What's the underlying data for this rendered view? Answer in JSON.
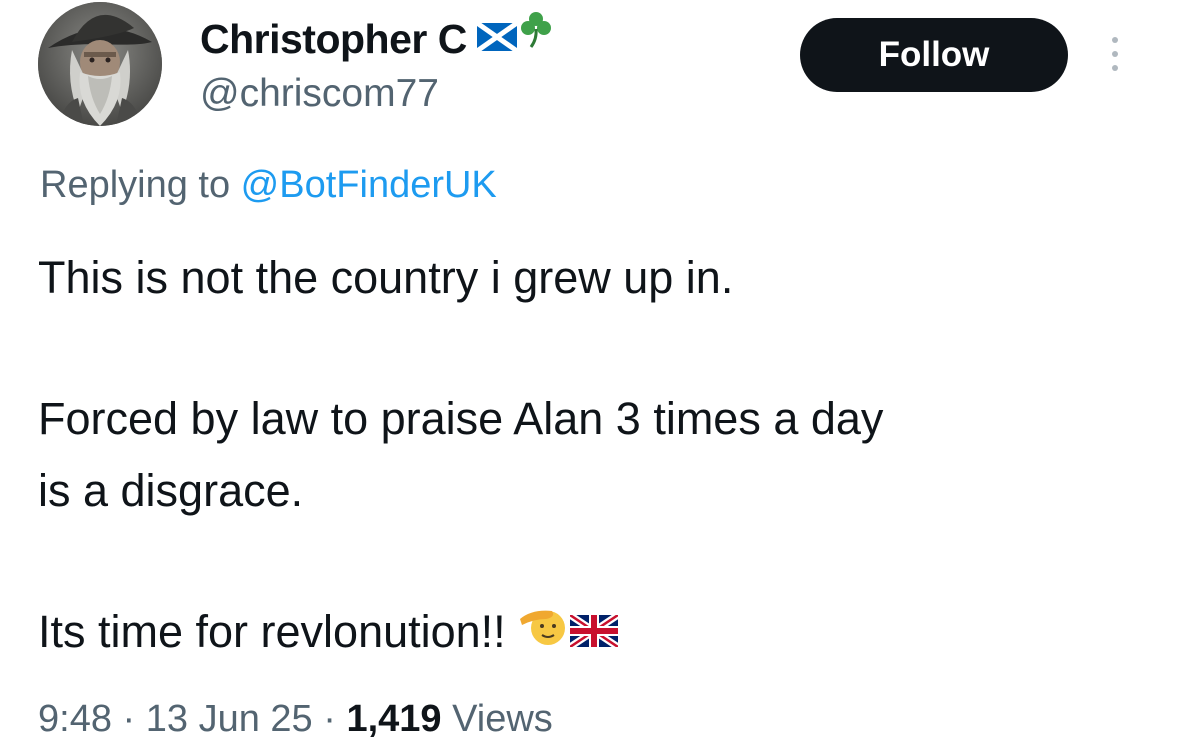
{
  "author": {
    "display_name": "Christopher C",
    "handle": "@chriscom77",
    "avatar": "wizard-portrait-avatar",
    "badges": [
      "scotland-flag-icon",
      "shamrock-icon"
    ]
  },
  "actions": {
    "follow_label": "Follow",
    "more_icon": "more-vertical-icon"
  },
  "reply": {
    "prefix": "Replying to ",
    "mention": "@BotFinderUK"
  },
  "tweet": {
    "line1": "This is not the country i grew up in.",
    "line2": "Forced by law to praise Alan 3 times a day",
    "line3": "is a disgrace.",
    "line4": "Its time for revlonution!!",
    "emojis": [
      "saluting-face-icon",
      "uk-flag-icon"
    ]
  },
  "meta": {
    "time": "9:48",
    "separator1": " · ",
    "date": "13 Jun 25",
    "separator2": " · ",
    "views_count": "1,419",
    "views_label": " Views"
  },
  "colors": {
    "text_primary": "#0f1419",
    "text_secondary": "#536471",
    "link": "#1d9bf0",
    "button_bg": "#0f1419",
    "button_text": "#ffffff"
  }
}
